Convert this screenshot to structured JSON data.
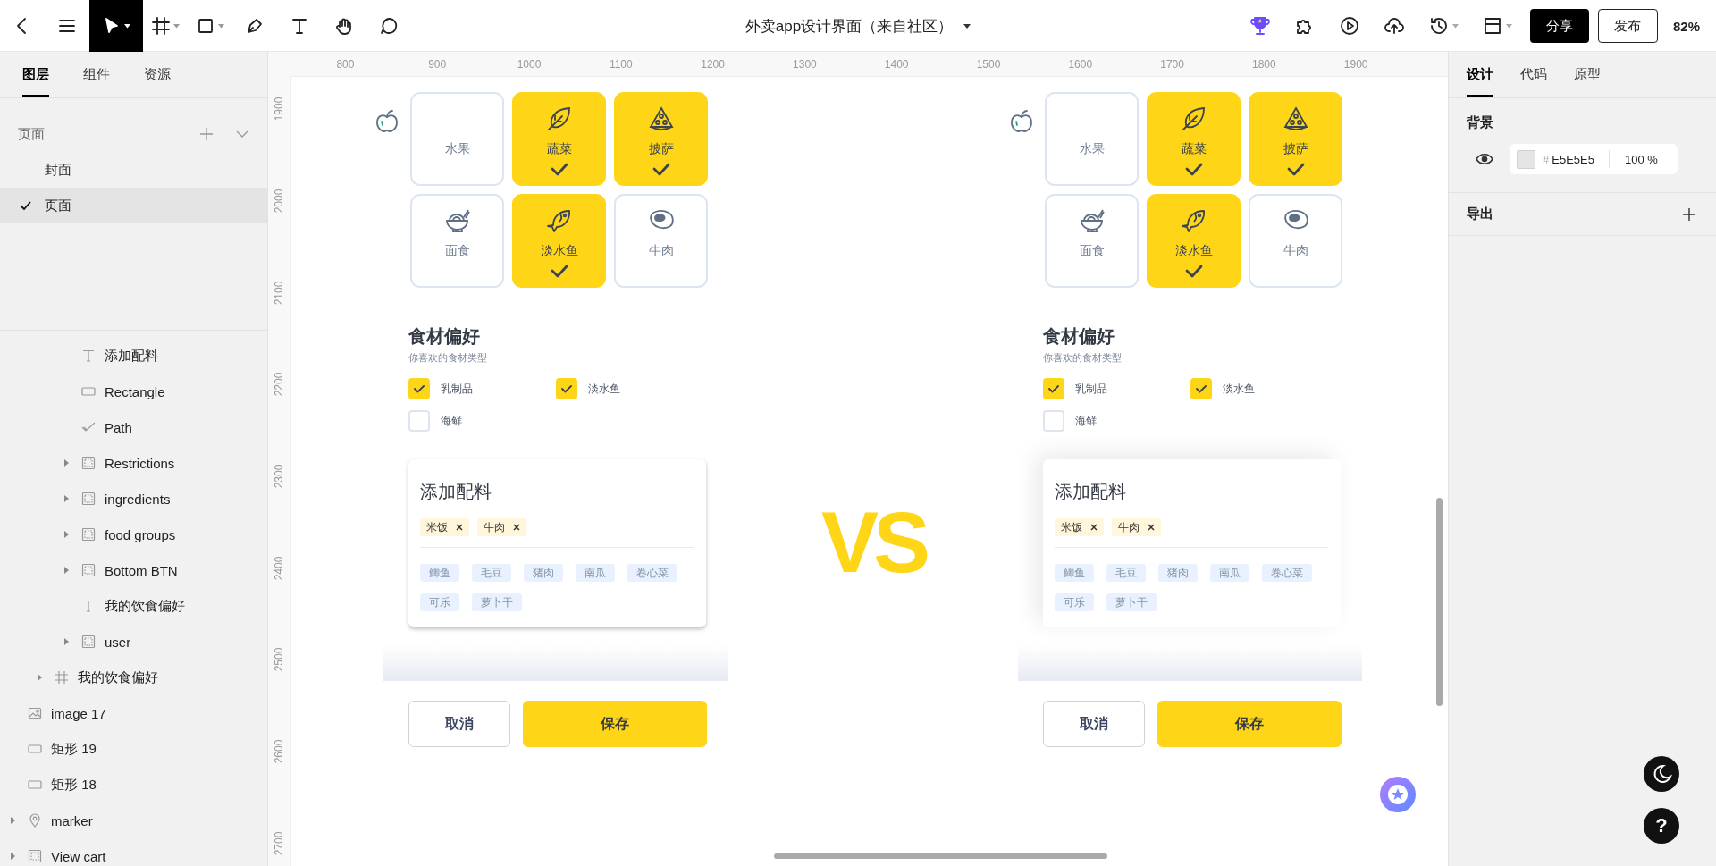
{
  "toolbar": {
    "tools": [
      {
        "kind": "back",
        "selected": false
      },
      {
        "kind": "menu",
        "selected": false
      },
      {
        "kind": "pointer",
        "selected": true
      },
      {
        "kind": "frame",
        "selected": false
      },
      {
        "kind": "shape",
        "selected": false
      },
      {
        "kind": "pen",
        "selected": false
      },
      {
        "kind": "text",
        "selected": false
      },
      {
        "kind": "hand",
        "selected": false
      },
      {
        "kind": "comment",
        "selected": false
      }
    ],
    "title": "外卖app设计界面（来自社区）",
    "actions": [
      {
        "kind": "trophy"
      },
      {
        "kind": "plugin"
      },
      {
        "kind": "play"
      },
      {
        "kind": "upload"
      },
      {
        "kind": "history"
      },
      {
        "kind": "layout"
      }
    ],
    "share": "分享",
    "publish": "发布",
    "zoom": "82%"
  },
  "left_panel": {
    "tabs": [
      {
        "label": "图层",
        "selected": true
      },
      {
        "label": "组件",
        "selected": false
      },
      {
        "label": "资源",
        "selected": false
      }
    ],
    "pages_title": "页面",
    "pages": [
      {
        "name": "封面",
        "selected": false
      },
      {
        "name": "页面",
        "selected": true
      }
    ],
    "layers": [
      {
        "children": [
          {
            "children": [
              {
                "name": "添加配料",
                "kind": "text"
              },
              {
                "name": "Rectangle",
                "kind": "rect"
              },
              {
                "name": "Path",
                "kind": "path"
              },
              {
                "name": "Restrictions",
                "kind": "group",
                "collapsed": true
              },
              {
                "name": "ingredients",
                "kind": "group",
                "collapsed": true
              },
              {
                "name": "food groups",
                "kind": "group",
                "collapsed": true
              },
              {
                "name": "Bottom BTN",
                "kind": "group",
                "collapsed": true
              },
              {
                "name": "我的饮食偏好",
                "kind": "text"
              },
              {
                "name": "user",
                "kind": "group",
                "collapsed": true
              }
            ]
          },
          {
            "name": "我的饮食偏好",
            "kind": "frame",
            "collapsed": true
          }
        ]
      },
      {
        "name": "image 17",
        "kind": "image"
      },
      {
        "name": "矩形 19",
        "kind": "rect"
      },
      {
        "name": "矩形 18",
        "kind": "rect"
      },
      {
        "name": "marker",
        "kind": "marker",
        "collapsed": true
      },
      {
        "name": "View cart",
        "kind": "group",
        "collapsed": true
      }
    ]
  },
  "canvas": {
    "ruler": {
      "x_labels": [
        "800",
        "900",
        "1000",
        "1100",
        "1200",
        "1300",
        "1400",
        "1500",
        "1600",
        "1700",
        "1800",
        "1900"
      ],
      "y_labels": [
        "1900",
        "2000",
        "2100",
        "2200",
        "2300",
        "2400",
        "2500",
        "2600",
        "2700"
      ]
    },
    "mockups": [
      {
        "kind": "outlined",
        "categories": [
          {
            "label": "水果",
            "kind": "fruit",
            "selected": false
          },
          {
            "label": "蔬菜",
            "kind": "leaf",
            "selected": true
          },
          {
            "label": "披萨",
            "kind": "pizza",
            "selected": true
          },
          {
            "label": "面食",
            "kind": "noodles",
            "selected": false
          },
          {
            "label": "淡水鱼",
            "kind": "fish",
            "selected": true
          },
          {
            "label": "牛肉",
            "kind": "meat",
            "selected": false
          }
        ],
        "preferences": {
          "title": "食材偏好",
          "subtitle": "你喜欢的食材类型",
          "options": [
            {
              "label": "乳制品",
              "checked": true
            },
            {
              "label": "淡水鱼",
              "checked": true
            },
            {
              "label": "海鲜",
              "checked": false
            }
          ]
        },
        "ingredients": {
          "title": "添加配料",
          "chosen": [
            "米饭",
            "牛肉"
          ],
          "suggestions": [
            "鲫鱼",
            "毛豆",
            "猪肉",
            "南瓜",
            "卷心菜",
            "可乐",
            "萝卜干"
          ]
        },
        "buttons": {
          "cancel": "取消",
          "save": "保存"
        }
      },
      {
        "kind": "soft",
        "categories": [
          {
            "label": "水果",
            "kind": "fruit",
            "selected": false
          },
          {
            "label": "蔬菜",
            "kind": "leaf",
            "selected": true
          },
          {
            "label": "披萨",
            "kind": "pizza",
            "selected": true
          },
          {
            "label": "面食",
            "kind": "noodles",
            "selected": false
          },
          {
            "label": "淡水鱼",
            "kind": "fish",
            "selected": true
          },
          {
            "label": "牛肉",
            "kind": "meat",
            "selected": false
          }
        ],
        "preferences": {
          "title": "食材偏好",
          "subtitle": "你喜欢的食材类型",
          "options": [
            {
              "label": "乳制品",
              "checked": true
            },
            {
              "label": "淡水鱼",
              "checked": true
            },
            {
              "label": "海鲜",
              "checked": false
            }
          ]
        },
        "ingredients": {
          "title": "添加配料",
          "chosen": [
            "米饭",
            "牛肉"
          ],
          "suggestions": [
            "鲫鱼",
            "毛豆",
            "猪肉",
            "南瓜",
            "卷心菜",
            "可乐",
            "萝卜干"
          ]
        },
        "buttons": {
          "cancel": "取消",
          "save": "保存"
        }
      }
    ],
    "vs": "VS"
  },
  "right_panel": {
    "tabs": [
      {
        "label": "设计",
        "selected": true
      },
      {
        "label": "代码",
        "selected": false
      },
      {
        "label": "原型",
        "selected": false
      }
    ],
    "background": {
      "title": "背景",
      "visible": true,
      "hash": "#",
      "hex": "E5E5E5",
      "opacity": "100 %"
    },
    "export": {
      "title": "导出"
    }
  },
  "help": "?"
}
